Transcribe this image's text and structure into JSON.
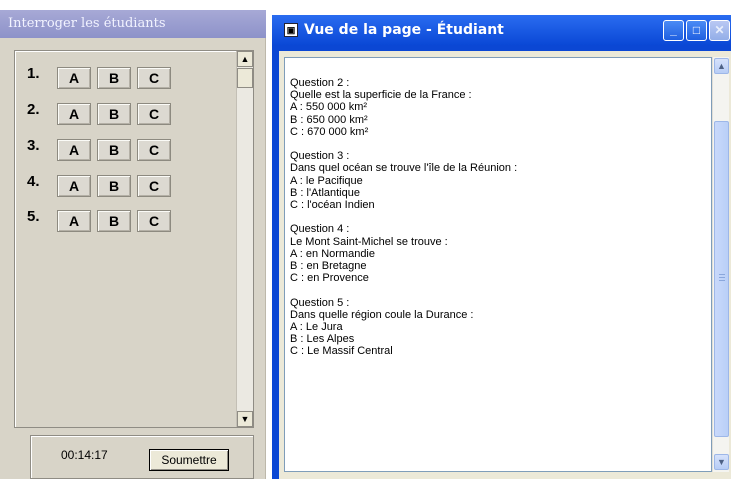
{
  "left_panel": {
    "title": "Interroger les étudiants",
    "questions": [
      {
        "number": "1.",
        "options": [
          "A",
          "B",
          "C"
        ]
      },
      {
        "number": "2.",
        "options": [
          "A",
          "B",
          "C"
        ]
      },
      {
        "number": "3.",
        "options": [
          "A",
          "B",
          "C"
        ]
      },
      {
        "number": "4.",
        "options": [
          "A",
          "B",
          "C"
        ]
      },
      {
        "number": "5.",
        "options": [
          "A",
          "B",
          "C"
        ]
      }
    ],
    "timer": "00:14:17",
    "submit_label": "Soumettre"
  },
  "window": {
    "title": "Vue de la page - Étudiant",
    "content_text": "Question 2 :\nQuelle est la superficie de la France :\nA : 550 000 km²\nB : 650 000 km²\nC : 670 000 km²\n\nQuestion 3 :\nDans quel océan se trouve l'île de la Réunion :\nA : le Pacifique\nB : l'Atlantique\nC : l'océan Indien\n\nQuestion 4 :\nLe Mont Saint-Michel se trouve :\nA : en Normandie\nB : en Bretagne\nC : en Provence\n\nQuestion 5 :\nDans quelle région coule la Durance :\nA : Le Jura\nB : Les Alpes\nC : Le Massif Central"
  },
  "icons": {
    "scroll_up": "scroll-up-arrow",
    "scroll_down": "scroll-down-arrow",
    "minimize": "minimize-icon",
    "maximize": "maximize-icon",
    "close": "close-icon"
  },
  "colors": {
    "titlebar": "#0a48d6",
    "left_title_bg": "#8d92c9",
    "panel_bg": "#d8d4c8"
  }
}
